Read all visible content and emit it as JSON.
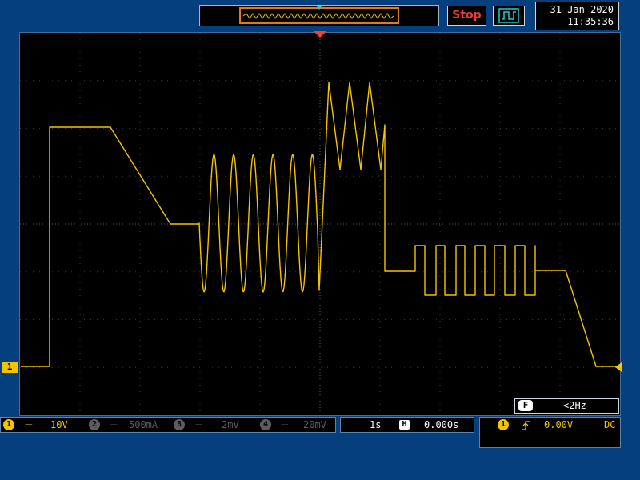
{
  "top": {
    "stop_label": "Stop",
    "date": "31 Jan 2020",
    "time": "11:35:36"
  },
  "channels": [
    {
      "num": "1",
      "scale": "10V",
      "active": true
    },
    {
      "num": "2",
      "scale": "500mA",
      "active": false
    },
    {
      "num": "3",
      "scale": "2mV",
      "active": false
    },
    {
      "num": "4",
      "scale": "20mV",
      "active": false
    }
  ],
  "ch1_marker": "1",
  "coupling_symbol": "⎓",
  "timebase": {
    "scale": "1s",
    "position_icon": "H",
    "position": "0.000s"
  },
  "trigger": {
    "source": "1",
    "slope": "rising-edge-icon",
    "level": "0.00V",
    "coupling": "DC"
  },
  "frequency": {
    "label": "F",
    "value": "<2Hz"
  },
  "colors": {
    "ch1": "#f5c400",
    "background": "#063f7d",
    "screen": "#000000",
    "stop": "#e53b3b",
    "trigger_marker": "#ff4020",
    "cyan": "#1fd0d0"
  }
}
